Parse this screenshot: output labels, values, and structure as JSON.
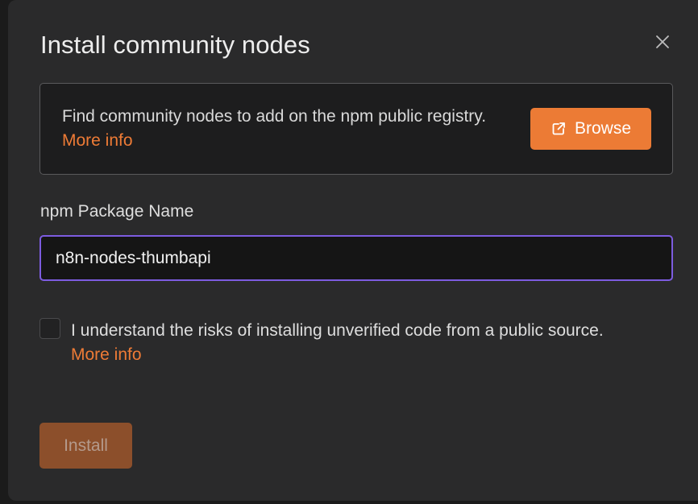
{
  "dialog": {
    "title": "Install community nodes",
    "close_icon": "close-icon"
  },
  "info_box": {
    "text": "Find community nodes to add on the npm public registry. ",
    "more_info_link": "More info",
    "browse_button": {
      "label": "Browse",
      "icon": "external-link-icon"
    }
  },
  "package_field": {
    "label": "npm Package Name",
    "value": "n8n-nodes-thumbapi"
  },
  "risk_checkbox": {
    "checked": false,
    "text": "I understand the risks of installing unverified code from a public source.",
    "more_info_link": "More info"
  },
  "install_button": {
    "label": "Install",
    "disabled": true
  },
  "colors": {
    "accent": "#ec7b35",
    "focus_border": "#7d5ce0",
    "modal_bg": "#2a2a2b"
  }
}
